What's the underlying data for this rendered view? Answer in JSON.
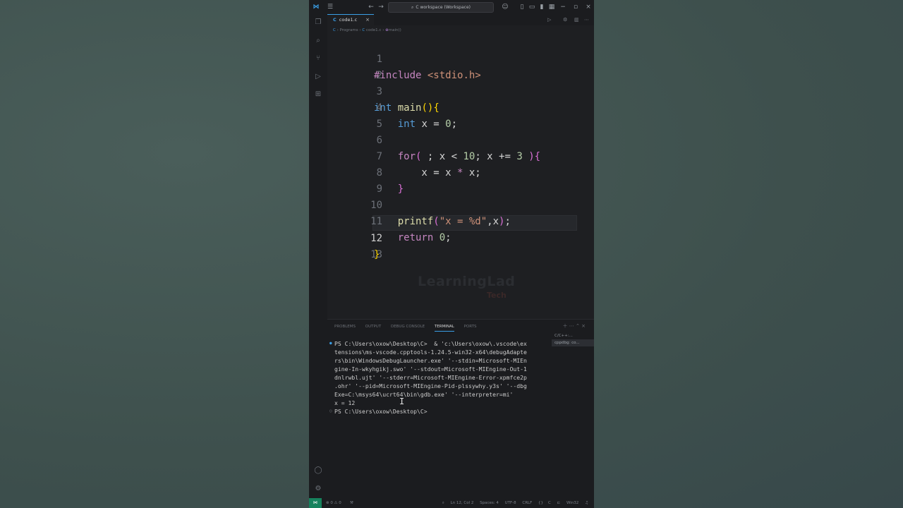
{
  "window": {
    "search_text": "C workspace (Workspace)"
  },
  "tabs": [
    {
      "label": "code1.c"
    }
  ],
  "breadcrumb": {
    "parts": [
      "C",
      "Programs",
      "code1.c",
      "main()"
    ]
  },
  "editor": {
    "line_numbers": [
      "1",
      "2",
      "3",
      "4",
      "5",
      "6",
      "7",
      "8",
      "9",
      "10",
      "11",
      "12",
      "13"
    ],
    "active_line": 12,
    "watermark": "LearningLad",
    "watermark_sub": "Tech"
  },
  "panel": {
    "tabs": [
      "PROBLEMS",
      "OUTPUT",
      "DEBUG CONSOLE",
      "TERMINAL",
      "PORTS"
    ],
    "active_tab": "TERMINAL",
    "terminal_lines": [
      "PS C:\\Users\\oxow\\Desktop\\C>  & 'c:\\Users\\oxow\\.vscode\\ex",
      "tensions\\ms-vscode.cpptools-1.24.5-win32-x64\\debugAdapte",
      "rs\\bin\\WindowsDebugLauncher.exe' '--stdin=Microsoft-MIEn",
      "gine-In-wkyhgikj.swo' '--stdout=Microsoft-MIEngine-Out-1",
      "dnlrwbl.ujt' '--stderr=Microsoft-MIEngine-Error-xpmfce2p",
      ".ohr' '--pid=Microsoft-MIEngine-Pid-plssywhy.y3s' '--dbg",
      "Exe=C:\\msys64\\ucrt64\\bin\\gdb.exe' '--interpreter=mi'",
      "x = 12",
      "PS C:\\Users\\oxow\\Desktop\\C>"
    ],
    "side_terminals": [
      "C/C++:...",
      "cppdbg: co..."
    ]
  },
  "statusbar": {
    "problems": "⊗ 0 ⚠ 0",
    "position": "Ln 12, Col 2",
    "spaces": "Spaces: 4",
    "encoding": "UTF-8",
    "eol": "CRLF",
    "language": "C",
    "platform": "Win32"
  }
}
